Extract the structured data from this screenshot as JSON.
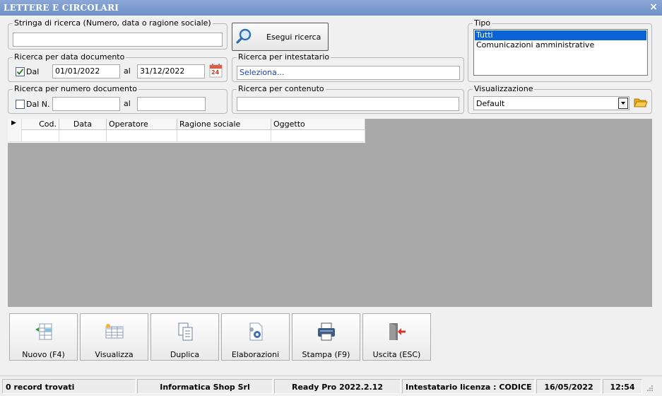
{
  "window": {
    "title": "LETTERE E CIRCOLARI",
    "close_glyph": "×"
  },
  "search_string": {
    "legend": "Stringa di ricerca (Numero, data o ragione sociale)",
    "value": ""
  },
  "search_button": {
    "label": "Esegui ricerca",
    "icon": "magnifier-icon"
  },
  "date_search": {
    "legend": "Ricerca per data documento",
    "from_checked": true,
    "from_label": "Dal",
    "from_value": "01/01/2022",
    "to_label": "al",
    "to_value": "31/12/2022",
    "calendar_day": "24"
  },
  "holder_search": {
    "legend": "Ricerca per intestatario",
    "value": "Seleziona..."
  },
  "number_search": {
    "legend": "Ricerca per numero documento",
    "from_checked": false,
    "from_label": "Dal N.",
    "from_value": "",
    "to_label": "al",
    "to_value": ""
  },
  "content_search": {
    "legend": "Ricerca per contenuto",
    "value": ""
  },
  "tipo": {
    "legend": "Tipo",
    "options": [
      "Tutti",
      "Comunicazioni amministrative"
    ],
    "selected": "Tutti"
  },
  "visualizzazione": {
    "legend": "Visualizzazione",
    "selected": "Default"
  },
  "grid": {
    "columns": [
      "Cod.",
      "Data",
      "Operatore",
      "Ragione sociale",
      "Oggetto"
    ],
    "row_indicator": "▶"
  },
  "toolbar": [
    {
      "label": "Nuovo (F4)",
      "icon": "new-record-icon"
    },
    {
      "label": "Visualizza",
      "icon": "view-table-icon"
    },
    {
      "label": "Duplica",
      "icon": "duplicate-icon"
    },
    {
      "label": "Elaborazioni",
      "icon": "process-gear-icon"
    },
    {
      "label": "Stampa (F9)",
      "icon": "printer-icon"
    },
    {
      "label": "Uscita (ESC)",
      "icon": "exit-door-icon"
    }
  ],
  "status": {
    "records": "0 record trovati",
    "company": "Informatica Shop Srl",
    "version": "Ready Pro 2022.2.12",
    "license": "Intestatario licenza : CODICE SRL",
    "date": "16/05/2022",
    "time": "12:54"
  },
  "colors": {
    "title_bar": "#7897cd",
    "selection": "#0a64d8",
    "grid_bg": "#a9a9a9",
    "link_blue": "#1a3fb0"
  }
}
